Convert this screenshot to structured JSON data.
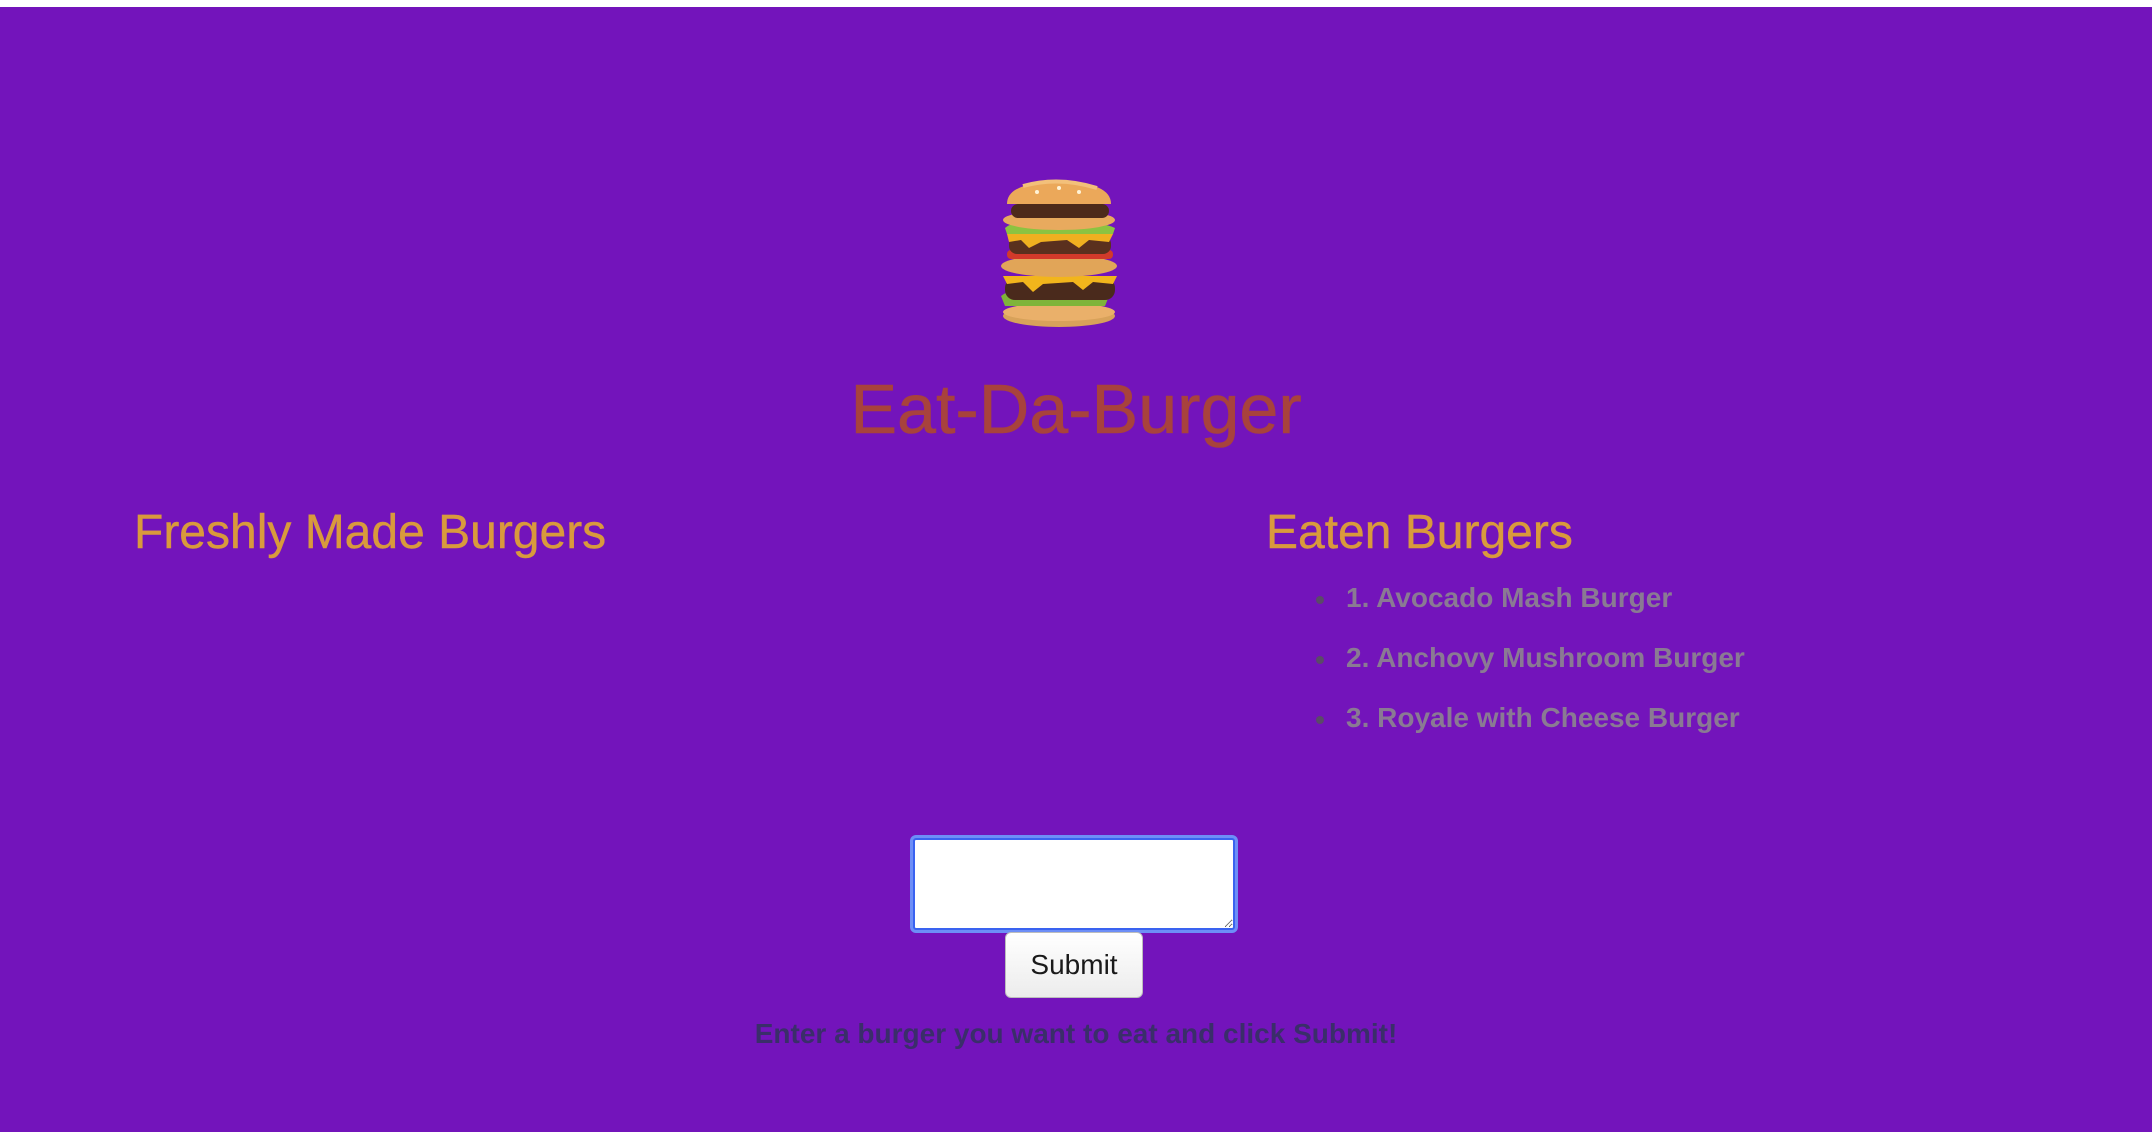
{
  "header": {
    "logo_icon": "burger-stack-icon",
    "title": "Eat-Da-Burger"
  },
  "fresh": {
    "heading": "Freshly Made Burgers",
    "items": []
  },
  "eaten": {
    "heading": "Eaten Burgers",
    "items": [
      "1. Avocado Mash Burger",
      "2. Anchovy Mushroom Burger",
      "3. Royale with Cheese Burger"
    ]
  },
  "form": {
    "input_value": "",
    "input_placeholder": "",
    "submit_label": "Submit",
    "instruction": "Enter a burger you want to eat and click Submit!"
  },
  "colors": {
    "background": "#7314bb",
    "title": "#a8423d",
    "heading": "#d99a3c",
    "list_text": "#8a7a93",
    "instruction": "#3a2e6a"
  }
}
